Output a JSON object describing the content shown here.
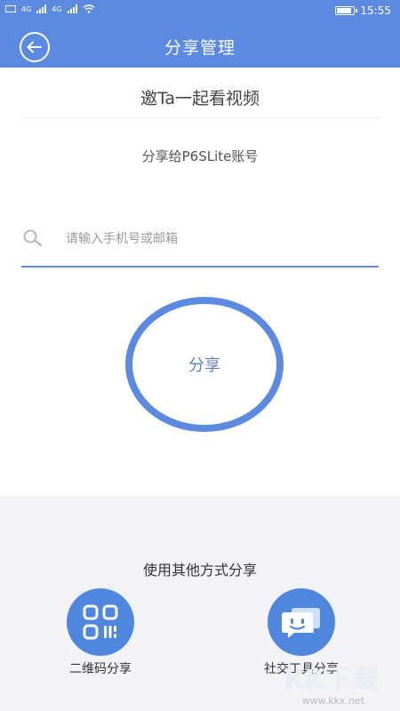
{
  "statusbar": {
    "time": "15:55",
    "network1": "4G",
    "network2": "4G",
    "battery_level": 0.9
  },
  "header": {
    "title": "分享管理",
    "back_icon": "back-arrow-icon"
  },
  "main": {
    "invite_text": "邀Ta一起看视频",
    "share_to_text": "分享给P6SLite账号",
    "search": {
      "placeholder": "请输入手机号或邮箱",
      "value": ""
    },
    "share_button_label": "分享"
  },
  "other_share": {
    "title": "使用其他方式分享",
    "options": [
      {
        "label": "二维码分享",
        "icon": "qr-code-icon"
      },
      {
        "label": "社交工具分享",
        "icon": "chat-bubble-icon"
      }
    ]
  },
  "watermark": {
    "text": "KK下载",
    "url": "www.kkx.net"
  },
  "colors": {
    "accent": "#5b8ae0",
    "icon_bg": "#4f86de",
    "bottom_bg": "#f3f3f5"
  }
}
